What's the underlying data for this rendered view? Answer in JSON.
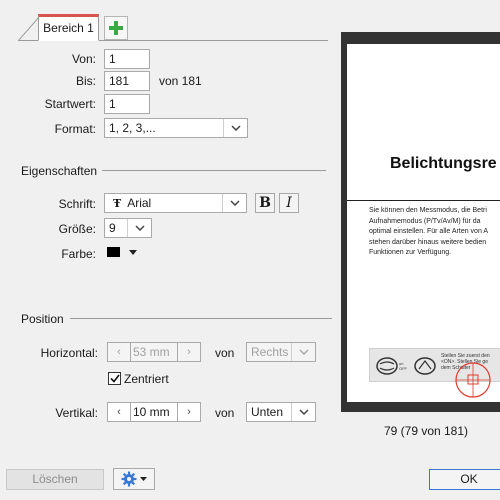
{
  "tabs": {
    "active_label": "Bereich 1",
    "add_icon": "plus-icon"
  },
  "range": {
    "from_label": "Von:",
    "from_value": "1",
    "to_label": "Bis:",
    "to_value": "181",
    "to_suffix": "von 181",
    "start_label": "Startwert:",
    "start_value": "1",
    "format_label": "Format:",
    "format_value": "1, 2, 3,..."
  },
  "properties": {
    "title": "Eigenschaften",
    "font_label": "Schrift:",
    "font_value": "Arial",
    "font_icon": "font-type-icon",
    "bold_label": "B",
    "italic_label": "I",
    "size_label": "Größe:",
    "size_value": "9",
    "color_label": "Farbe:",
    "color_value": "#000000"
  },
  "position": {
    "title": "Position",
    "horizontal_label": "Horizontal:",
    "horizontal_value": "53 mm",
    "horizontal_of": "von",
    "horizontal_anchor": "Rechts",
    "centered_label": "Zentriert",
    "centered_checked": true,
    "vertical_label": "Vertikal:",
    "vertical_value": "10 mm",
    "vertical_of": "von",
    "vertical_anchor": "Unten"
  },
  "buttons": {
    "delete_label": "Löschen",
    "settings_icon": "gear-icon",
    "ok_label": "OK"
  },
  "preview": {
    "heading": "Belichtungsre",
    "body_text": "Sie können den Messmodus, die Betri\nAufnahmemodus (P/Tv/Av/M) für da\noptimal einstellen. Für alle Arten von A\nstehen darüber hinaus weitere bedien\nFunktionen zur Verfügung.",
    "box_text": "Stellen Sie zuerst den\n<ON>. Stellen Sie ge\ndem Schalter",
    "box_small_text": "on\nOFF",
    "caption": "79 (79 von 181)"
  },
  "colors": {
    "tab_accent": "#d9534f",
    "add_icon_green": "#3aa845",
    "ok_border": "#3a78d6",
    "marker_red": "#e03a2f"
  }
}
